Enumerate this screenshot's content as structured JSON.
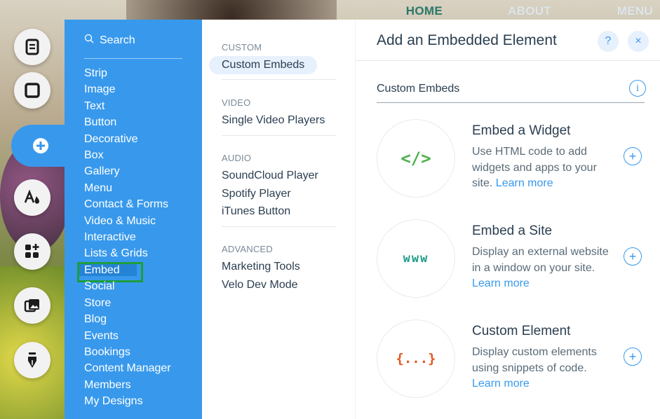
{
  "site_nav": {
    "items": [
      "HOME",
      "ABOUT",
      "MENU"
    ],
    "active": "HOME"
  },
  "rail": {
    "buttons": [
      {
        "icon": "pages-icon",
        "label": ""
      },
      {
        "icon": "background-icon",
        "label": ""
      },
      {
        "icon": "add-icon",
        "label": ""
      },
      {
        "icon": "theme-icon",
        "label": ""
      },
      {
        "icon": "apps-icon",
        "label": ""
      },
      {
        "icon": "media-icon",
        "label": ""
      },
      {
        "icon": "blog-pen-icon",
        "label": ""
      }
    ]
  },
  "categories": {
    "search_label": "Search",
    "items": [
      "Strip",
      "Image",
      "Text",
      "Button",
      "Decorative",
      "Box",
      "Gallery",
      "Menu",
      "Contact & Forms",
      "Video & Music",
      "Interactive",
      "Lists & Grids",
      "Embed",
      "Social",
      "Store",
      "Blog",
      "Events",
      "Bookings",
      "Content Manager",
      "Members",
      "My Designs"
    ],
    "selected": "Embed"
  },
  "subcategories": {
    "groups": [
      {
        "heading": "CUSTOM",
        "items": [
          "Custom Embeds"
        ]
      },
      {
        "heading": "VIDEO",
        "items": [
          "Single Video Players"
        ]
      },
      {
        "heading": "AUDIO",
        "items": [
          "SoundCloud Player",
          "Spotify Player",
          "iTunes Button"
        ]
      },
      {
        "heading": "ADVANCED",
        "items": [
          "Marketing Tools",
          "Velo Dev Mode"
        ]
      }
    ],
    "selected": "Custom Embeds"
  },
  "detail": {
    "title": "Add an Embedded Element",
    "help_label": "?",
    "close_label": "×",
    "section_title": "Custom Embeds",
    "info_label": "i",
    "embeds": [
      {
        "icon_text": "</>",
        "icon_color": "#4eb14e",
        "title": "Embed a Widget",
        "desc": "Use HTML code to add widgets and apps to your site.",
        "link": "Learn more"
      },
      {
        "icon_text": "www",
        "icon_color": "#1f9b8a",
        "title": "Embed a Site",
        "desc": "Display an external website in a window on your site.",
        "link": "Learn more"
      },
      {
        "icon_text": "{...}",
        "icon_color": "#e5581f",
        "title": "Custom Element",
        "desc": "Display custom elements using snippets of code.",
        "link": "Learn more"
      }
    ]
  },
  "colors": {
    "accent": "#3899ec",
    "selected_outline": "#1e9e3c",
    "text_dark": "#2b3e50"
  }
}
